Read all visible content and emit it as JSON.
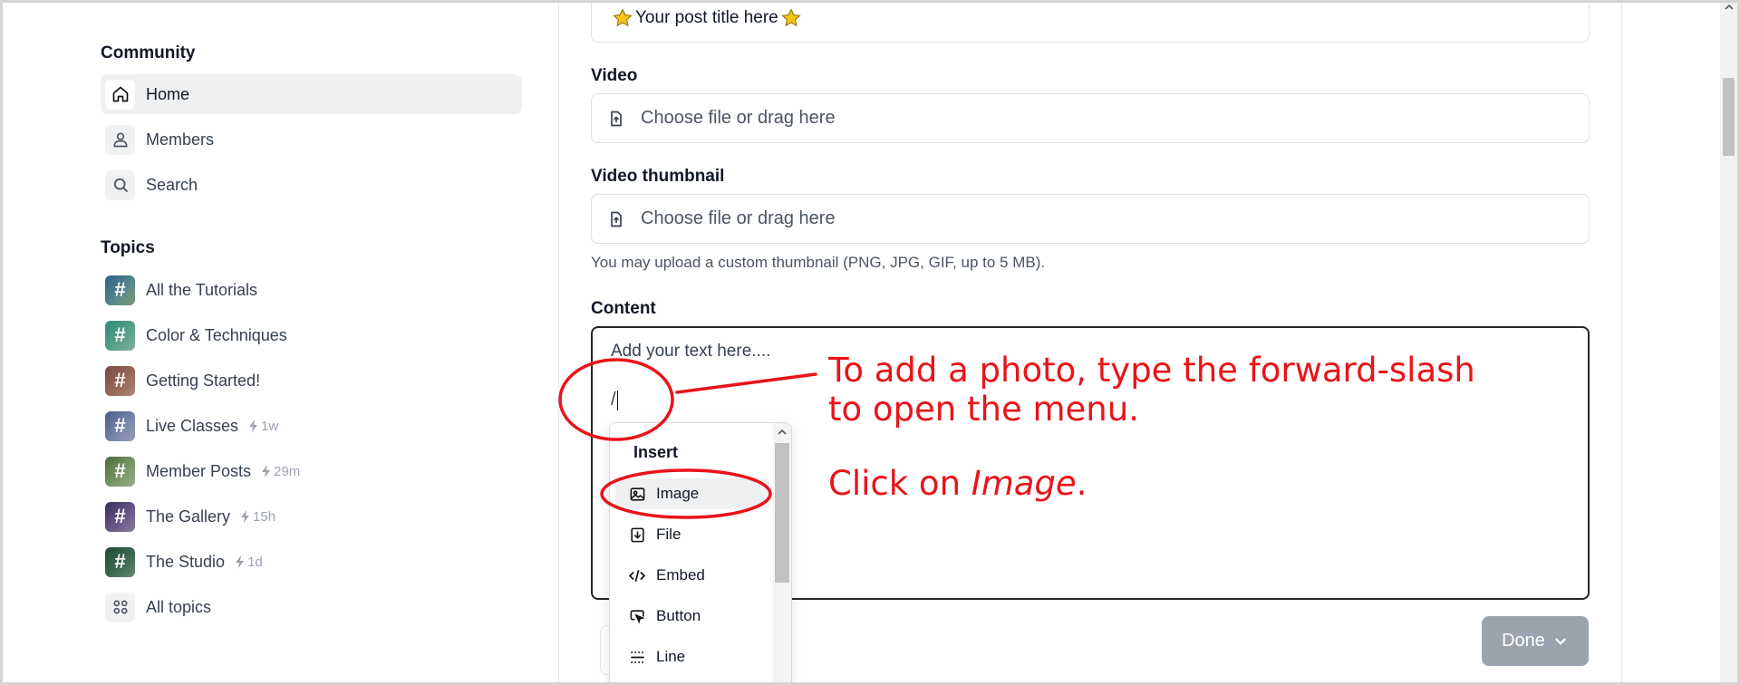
{
  "sidebar": {
    "community_heading": "Community",
    "community_items": [
      {
        "label": "Home",
        "icon": "home-icon",
        "active": true
      },
      {
        "label": "Members",
        "icon": "user-icon"
      },
      {
        "label": "Search",
        "icon": "search-icon"
      }
    ],
    "topics_heading": "Topics",
    "topics": [
      {
        "label": "All the Tutorials",
        "meta": "",
        "color": "#3b6b8c"
      },
      {
        "label": "Color & Techniques",
        "meta": "",
        "color": "#3f8f7a"
      },
      {
        "label": "Getting Started!",
        "meta": "",
        "color": "#8a5a52"
      },
      {
        "label": "Live Classes",
        "meta": "1w",
        "color": "#5a6a9a"
      },
      {
        "label": "Member Posts",
        "meta": "29m",
        "color": "#5b7f5a"
      },
      {
        "label": "The Gallery",
        "meta": "15h",
        "color": "#4a3f6b"
      },
      {
        "label": "The Studio",
        "meta": "1d",
        "color": "#2f5a44"
      }
    ],
    "all_topics_label": "All topics"
  },
  "form": {
    "post_title_value": "Your post title here",
    "video_label": "Video",
    "video_placeholder": "Choose file or drag here",
    "thumbnail_label": "Video thumbnail",
    "thumbnail_placeholder": "Choose file or drag here",
    "thumbnail_helper": "You may upload a custom thumbnail (PNG, JPG, GIF, up to 5 MB).",
    "content_label": "Content",
    "content_placeholder": "Add your text here....",
    "content_typed": "/",
    "done_label": "Done"
  },
  "insert_menu": {
    "heading": "Insert",
    "items": [
      {
        "label": "Image",
        "icon": "image-icon"
      },
      {
        "label": "File",
        "icon": "file-download-icon"
      },
      {
        "label": "Embed",
        "icon": "code-icon"
      },
      {
        "label": "Button",
        "icon": "button-cursor-icon"
      },
      {
        "label": "Line",
        "icon": "divider-line-icon"
      }
    ]
  },
  "annotation": {
    "line1": "To add a photo, type the forward-slash",
    "line2": "to open the menu.",
    "line3_prefix": "Click on ",
    "line3_italic": "Image",
    "line3_suffix": ".",
    "color": "#e8141a"
  }
}
